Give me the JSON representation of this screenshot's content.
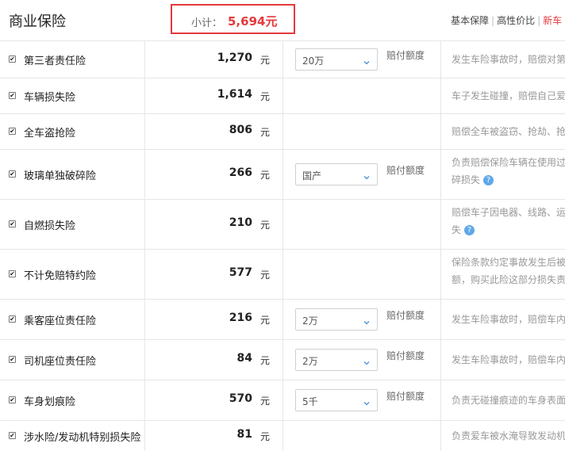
{
  "header": {
    "title": "商业保险",
    "subtotal_label": "小计：",
    "subtotal_value": "5,694元",
    "plans": [
      "基本保障",
      "高性价比",
      "新车"
    ]
  },
  "currency_unit": "元",
  "rows": [
    {
      "checked": true,
      "name": "第三者责任险",
      "price": "1,270",
      "select": "20万",
      "amount_label": "赔付额度",
      "desc": [
        "发生车险事故时，赔偿对第"
      ],
      "help": false
    },
    {
      "checked": true,
      "name": "车辆损失险",
      "price": "1,614",
      "select": null,
      "amount_label": null,
      "desc": [
        "车子发生碰撞，赔偿自己爱"
      ],
      "help": false
    },
    {
      "checked": true,
      "name": "全车盗抢险",
      "price": "806",
      "select": null,
      "amount_label": null,
      "desc": [
        "赔偿全车被盗窃、抢劫、抢"
      ],
      "help": false
    },
    {
      "checked": true,
      "name": "玻璃单独破碎险",
      "price": "266",
      "select": "国产",
      "amount_label": "赔付额度",
      "desc": [
        "负责赔偿保险车辆在使用过",
        "碎损失"
      ],
      "help": true
    },
    {
      "checked": true,
      "name": "自燃损失险",
      "price": "210",
      "select": null,
      "amount_label": null,
      "desc": [
        "赔偿车子因电器、线路、运",
        "失"
      ],
      "help": true
    },
    {
      "checked": true,
      "name": "不计免赔特约险",
      "price": "577",
      "select": null,
      "amount_label": null,
      "desc": [
        "保险条款约定事故发生后被",
        "额，购买此险这部分损失责"
      ],
      "help": false
    },
    {
      "checked": true,
      "name": "乘客座位责任险",
      "price": "216",
      "select": "2万",
      "amount_label": "赔付额度",
      "desc": [
        "发生车险事故时，赔偿车内"
      ],
      "help": false
    },
    {
      "checked": true,
      "name": "司机座位责任险",
      "price": "84",
      "select": "2万",
      "amount_label": "赔付额度",
      "desc": [
        "发生车险事故时，赔偿车内"
      ],
      "help": false
    },
    {
      "checked": true,
      "name": "车身划痕险",
      "price": "570",
      "select": "5千",
      "amount_label": "赔付额度",
      "desc": [
        "负责无碰撞痕迹的车身表面"
      ],
      "help": false
    },
    {
      "checked": true,
      "name": "涉水险/发动机特别损失险",
      "price": "81",
      "select": null,
      "amount_label": null,
      "desc": [
        "负责爱车被水淹导致发动机"
      ],
      "help": false
    }
  ]
}
